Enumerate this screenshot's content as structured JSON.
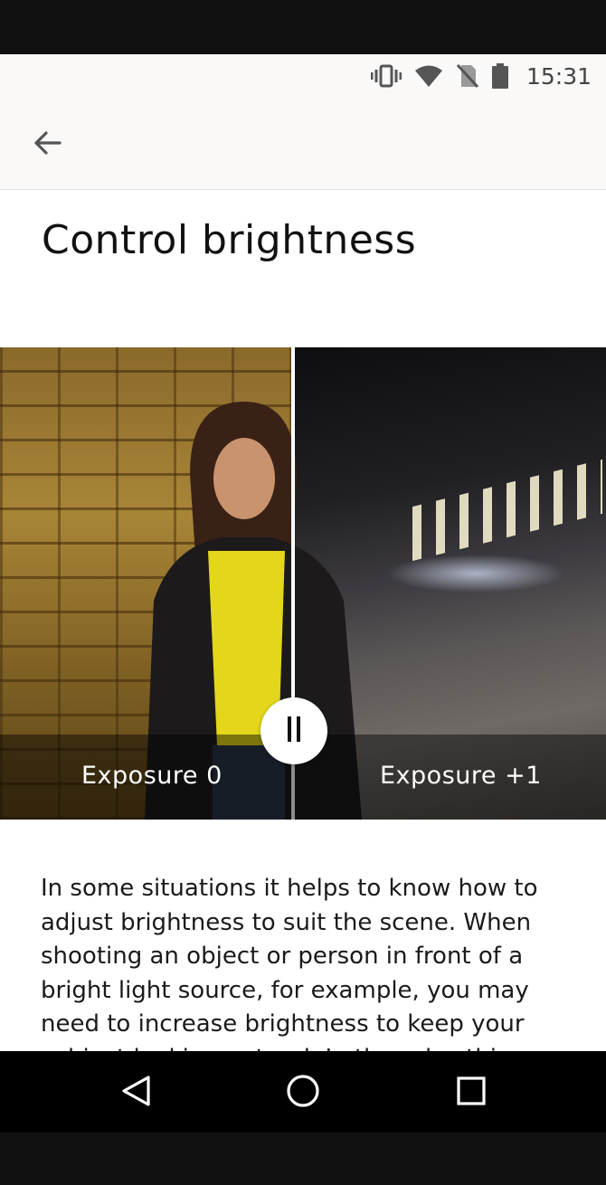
{
  "status_bar": {
    "time": "15:31",
    "icons": [
      "vibrate-icon",
      "wifi-icon",
      "no-sim-icon",
      "battery-icon"
    ]
  },
  "app_bar": {
    "back_icon": "arrow-left-icon"
  },
  "page": {
    "title": "Control brightness",
    "comparison": {
      "left_label": "Exposure 0",
      "right_label": "Exposure +1",
      "control_icon": "pause-icon"
    },
    "body": "In some situations it helps to know how to adjust brightness to suit the scene. When shooting an object or person in front of a bright light source, for example, you may need to increase brightness to keep your subject looking natural. In the rules this"
  },
  "nav_bar": {
    "icons": [
      "back-triangle-icon",
      "home-circle-icon",
      "recents-square-icon"
    ]
  },
  "colors": {
    "accent_text": "#111111",
    "overlay": "rgba(0,0,0,0.45)",
    "appbar_bg": "#faf9f8"
  }
}
